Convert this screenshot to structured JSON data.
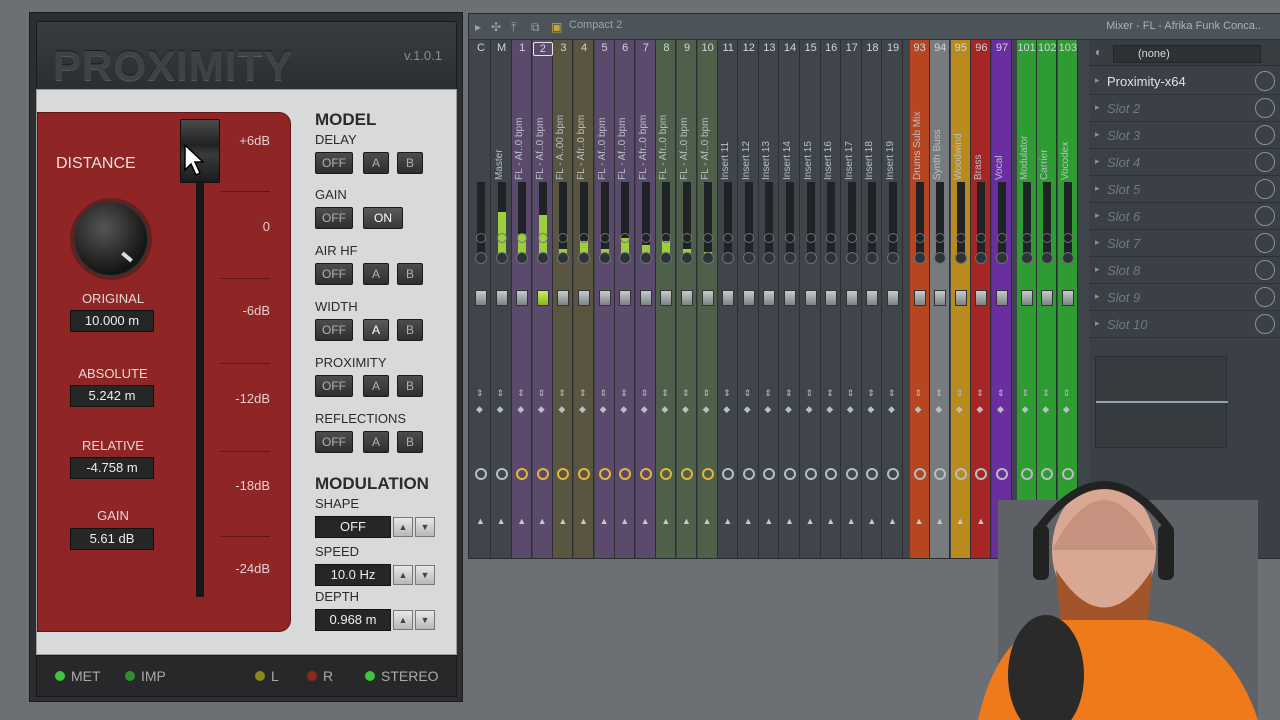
{
  "plugin": {
    "title": "PROXIMITY",
    "version": "v.1.0.1",
    "distance_label": "DISTANCE",
    "readouts": [
      {
        "label": "ORIGINAL",
        "value": "10.000 m"
      },
      {
        "label": "ABSOLUTE",
        "value": "5.242 m"
      },
      {
        "label": "RELATIVE",
        "value": "-4.758 m"
      },
      {
        "label": "GAIN",
        "value": "5.61 dB"
      }
    ],
    "db_scale": [
      "+6dB",
      "0",
      "-6dB",
      "-12dB",
      "-18dB",
      "-24dB"
    ],
    "model": {
      "title": "MODEL",
      "rows": [
        {
          "label": "DELAY",
          "off": "OFF",
          "a": "A",
          "b": "B"
        },
        {
          "label": "GAIN",
          "off": "OFF",
          "on": "ON"
        },
        {
          "label": "AIR HF",
          "off": "OFF",
          "a": "A",
          "b": "B"
        },
        {
          "label": "WIDTH",
          "off": "OFF",
          "a": "A",
          "b": "B"
        },
        {
          "label": "PROXIMITY",
          "off": "OFF",
          "a": "A",
          "b": "B"
        },
        {
          "label": "REFLECTIONS",
          "off": "OFF",
          "a": "A",
          "b": "B"
        }
      ]
    },
    "modulation": {
      "title": "MODULATION",
      "shape_label": "SHAPE",
      "shape_value": "OFF",
      "speed_label": "SPEED",
      "speed_value": "10.0 Hz",
      "depth_label": "DEPTH",
      "depth_value": "0.968 m"
    },
    "footer": {
      "met": "MET",
      "imp": "IMP",
      "l": "L",
      "r": "R",
      "stereo": "STEREO"
    },
    "colors": {
      "panel_red": "#8f2525",
      "led_green": "#3ec43e",
      "led_olive": "#8c8a1e",
      "led_red": "#8a2a1a"
    }
  },
  "mixer": {
    "preset": "Compact 2",
    "title": "Mixer - FL - Afrika Funk Conca..",
    "strips": [
      {
        "num": "C",
        "name": "",
        "color": "#3f454a"
      },
      {
        "num": "M",
        "name": "Master",
        "color": "#3f454a"
      },
      {
        "num": "1",
        "name": "FL - Af..0 bpm",
        "color": "#5c4a6d"
      },
      {
        "num": "2",
        "name": "FL - Af..0 bpm",
        "color": "#5c4a6d",
        "selected": true
      },
      {
        "num": "3",
        "name": "FL - A..00 bpm",
        "color": "#5a5540"
      },
      {
        "num": "4",
        "name": "FL - Afr..0 bpm",
        "color": "#5a5540"
      },
      {
        "num": "5",
        "name": "FL - Af..0 bpm",
        "color": "#5c4a6d"
      },
      {
        "num": "6",
        "name": "FL - Af..0 bpm",
        "color": "#5c4a6d"
      },
      {
        "num": "7",
        "name": "FL - Afr..0 bpm",
        "color": "#5c4a6d"
      },
      {
        "num": "8",
        "name": "FL - Afr..0 bpm",
        "color": "#4e5f4a"
      },
      {
        "num": "9",
        "name": "FL - Af..0 bpm",
        "color": "#4e5f4a"
      },
      {
        "num": "10",
        "name": "FL - Af..0 bpm",
        "color": "#4e5f4a"
      },
      {
        "num": "11",
        "name": "Insert 11",
        "color": "#3f454a"
      },
      {
        "num": "12",
        "name": "Insert 12",
        "color": "#3f454a"
      },
      {
        "num": "13",
        "name": "Insert 13",
        "color": "#3f454a"
      },
      {
        "num": "14",
        "name": "Insert 14",
        "color": "#3f454a"
      },
      {
        "num": "15",
        "name": "Insert 15",
        "color": "#3f454a"
      },
      {
        "num": "16",
        "name": "Insert 16",
        "color": "#3f454a"
      },
      {
        "num": "17",
        "name": "Insert 17",
        "color": "#3f454a"
      },
      {
        "num": "18",
        "name": "Insert 18",
        "color": "#3f454a"
      },
      {
        "num": "19",
        "name": "Insert 19",
        "color": "#3f454a"
      },
      {
        "num": "93",
        "name": "Drums Sub Mix",
        "color": "#b5461f"
      },
      {
        "num": "94",
        "name": "Synth Buss",
        "color": "#777b7e"
      },
      {
        "num": "95",
        "name": "Woodwind",
        "color": "#b98a1d"
      },
      {
        "num": "96",
        "name": "Brass",
        "color": "#a62525"
      },
      {
        "num": "97",
        "name": "Vocal",
        "color": "#6a2ea0"
      },
      {
        "num": "101",
        "name": "Modulator",
        "color": "#2f9b33"
      },
      {
        "num": "102",
        "name": "Carrier",
        "color": "#2f9b33"
      },
      {
        "num": "103",
        "name": "Vocodex",
        "color": "#2f9b33"
      }
    ],
    "meters": [
      0,
      0.6,
      0.3,
      0.55,
      0.1,
      0.2,
      0.1,
      0.25,
      0.15,
      0.2,
      0.1,
      0.05,
      0,
      0,
      0,
      0,
      0,
      0,
      0,
      0,
      0,
      0,
      0,
      0,
      0,
      0,
      0,
      0,
      0
    ],
    "slots": {
      "selected": "(none)",
      "items": [
        "Proximity-x64",
        "Slot 2",
        "Slot 3",
        "Slot 4",
        "Slot 5",
        "Slot 6",
        "Slot 7",
        "Slot 8",
        "Slot 9",
        "Slot 10"
      ]
    }
  }
}
